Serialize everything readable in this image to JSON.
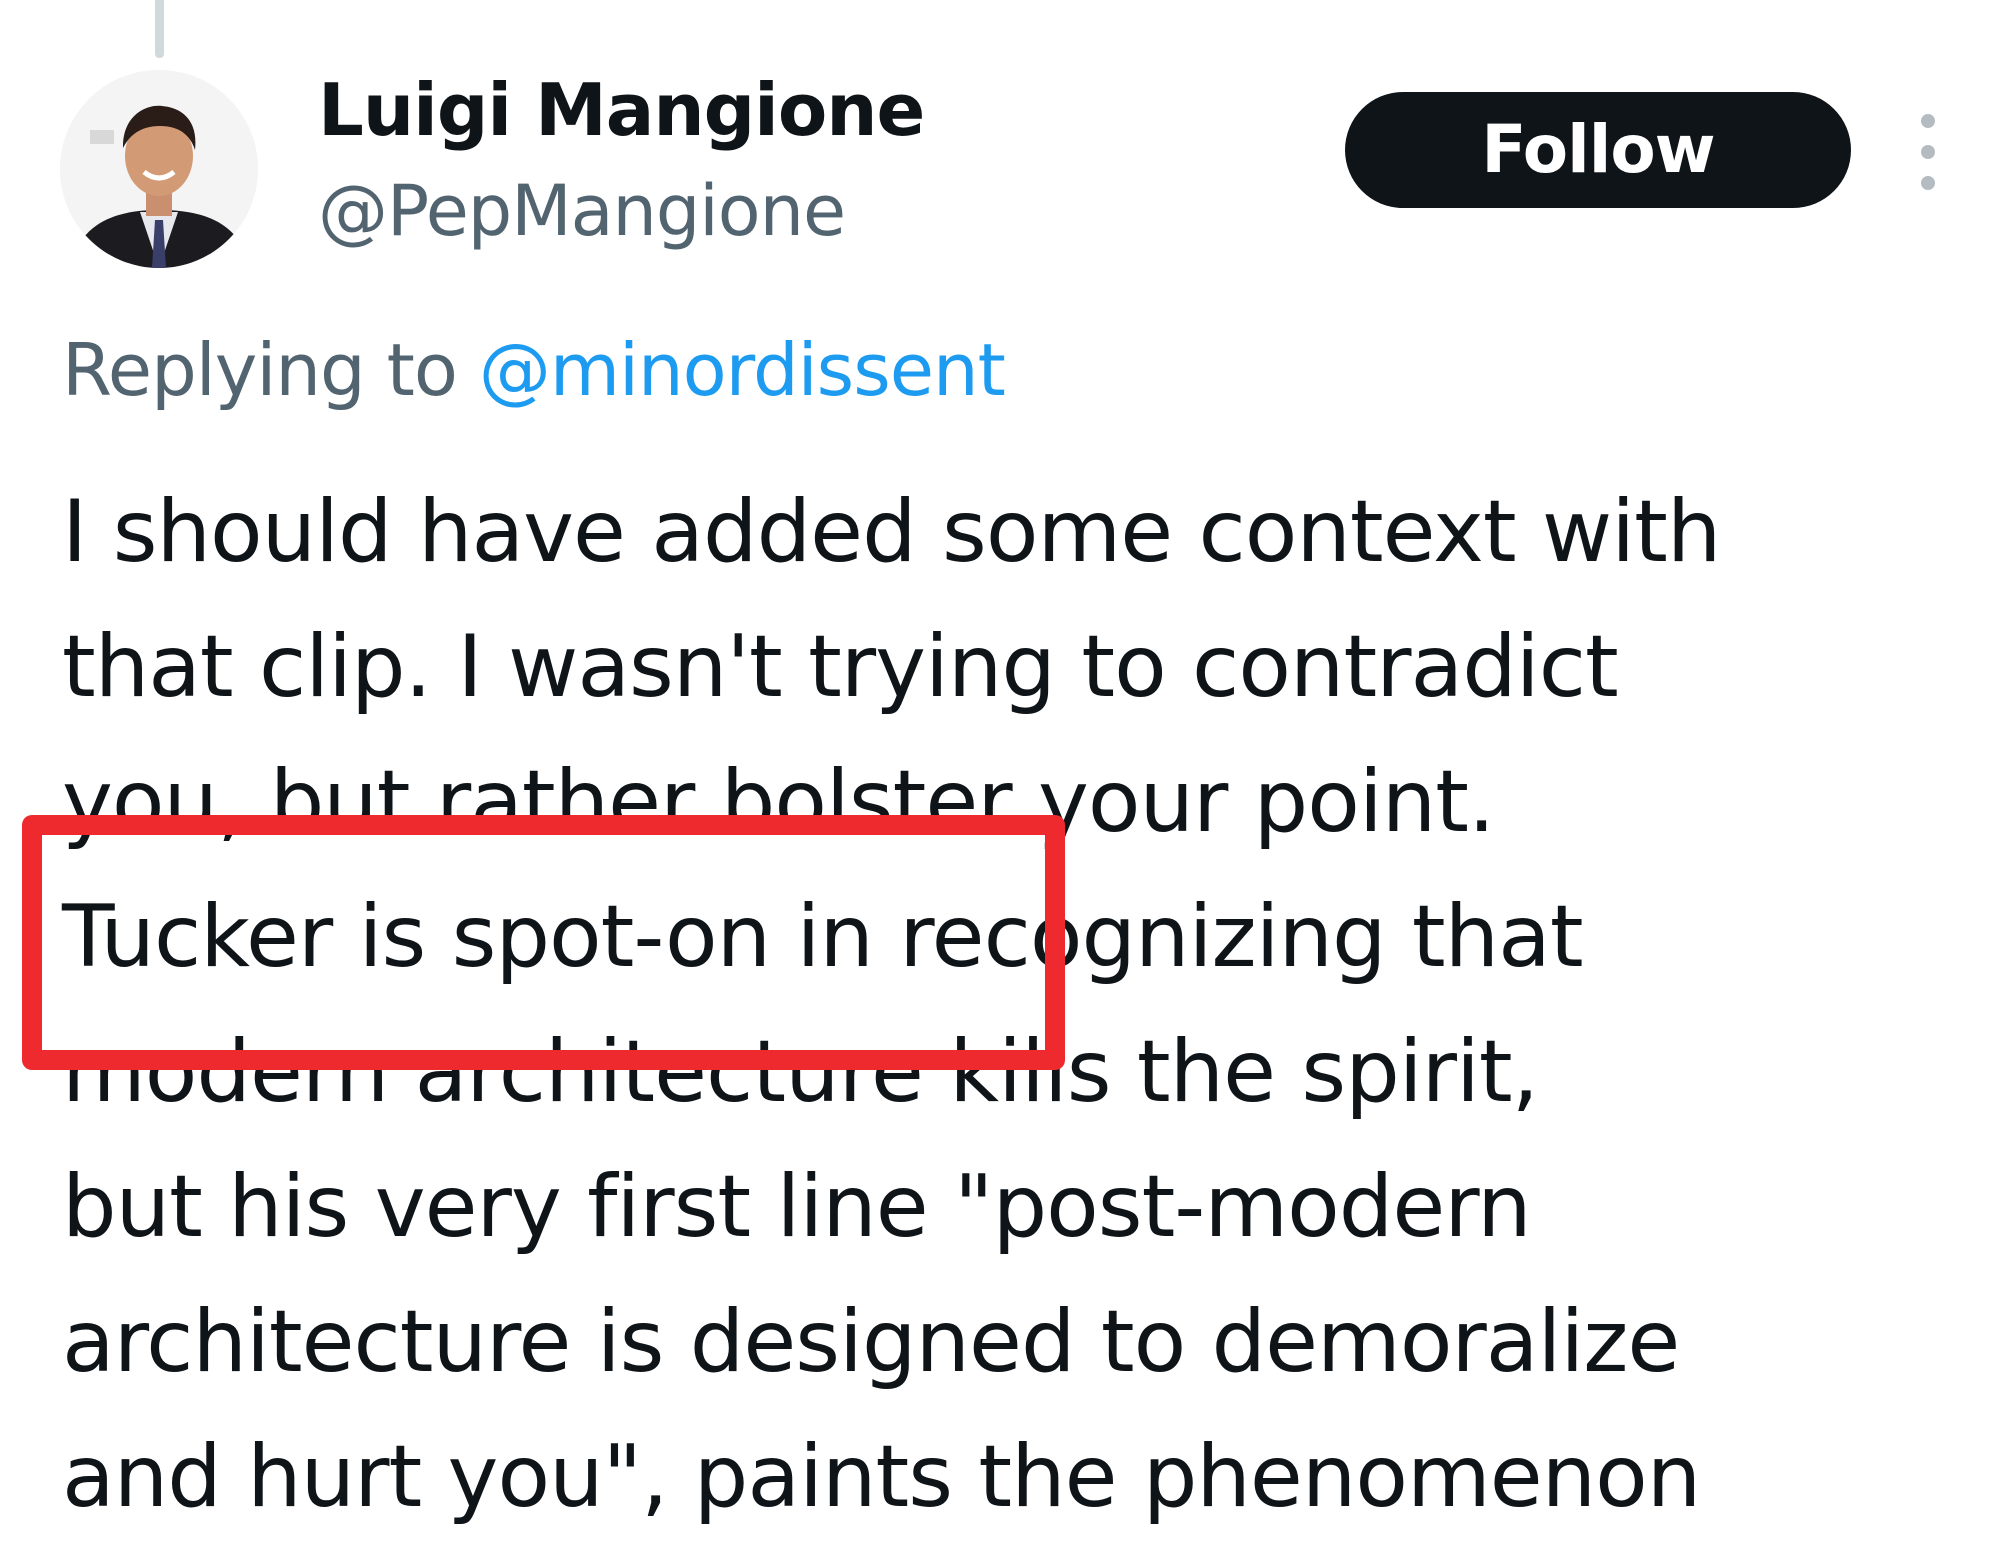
{
  "tweet": {
    "author_name": "Luigi Mangione",
    "author_handle": "@PepMangione",
    "follow_label": "Follow",
    "more_icon": "more-vertical-icon",
    "reply_prefix": "Replying to",
    "reply_mention": "@minordissent",
    "text_lines": [
      "I should have added some context with",
      "that clip. I wasn't trying to contradict",
      "you, but rather bolster your point.",
      "Tucker is spot-on in recognizing that",
      "modern architecture kills the spirit,",
      "but his very first line \"post-modern",
      "architecture is designed to demoralize",
      "and hurt you\", paints the phenomenon"
    ]
  },
  "colors": {
    "follow_button_bg": "#0f1419",
    "mention_blue": "#1d9bf0",
    "secondary_text": "#536471",
    "annotation_red": "#ee2a2e"
  }
}
